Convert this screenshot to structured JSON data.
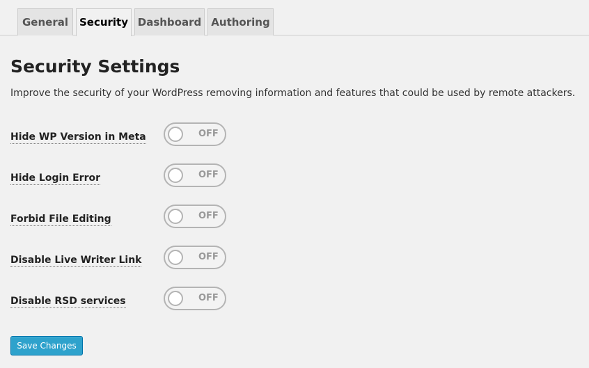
{
  "tabs": [
    {
      "label": "General",
      "active": false
    },
    {
      "label": "Security",
      "active": true
    },
    {
      "label": "Dashboard",
      "active": false
    },
    {
      "label": "Authoring",
      "active": false
    }
  ],
  "page": {
    "title": "Security Settings",
    "description": "Improve the security of your WordPress removing information and features that could be used by remote attackers."
  },
  "settings": [
    {
      "label": "Hide WP Version in Meta",
      "state": "OFF"
    },
    {
      "label": "Hide Login Error",
      "state": "OFF"
    },
    {
      "label": "Forbid File Editing",
      "state": "OFF"
    },
    {
      "label": "Disable Live Writer Link",
      "state": "OFF"
    },
    {
      "label": "Disable RSD services",
      "state": "OFF"
    }
  ],
  "actions": {
    "save_label": "Save Changes"
  },
  "colors": {
    "background": "#f1f1f1",
    "primary_button": "#2ea2cc",
    "toggle_border": "#b4b4b4",
    "toggle_text": "#999999"
  }
}
